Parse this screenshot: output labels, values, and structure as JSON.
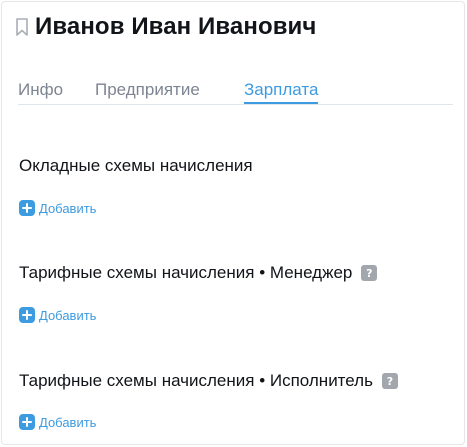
{
  "header": {
    "title": "Иванов Иван Иванович",
    "bookmark_icon": "bookmark-icon"
  },
  "tabs": [
    {
      "label": "Инфо",
      "active": false
    },
    {
      "label": "Предприятие",
      "active": false
    },
    {
      "label": "Зарплата",
      "active": true
    }
  ],
  "sections": [
    {
      "title": "Окладные схемы начисления",
      "help": false,
      "add_label": "Добавить"
    },
    {
      "title": "Тарифные схемы начисления • Менеджер",
      "help": true,
      "help_text": "?",
      "add_label": "Добавить"
    },
    {
      "title": "Тарифные схемы начисления • Исполнитель",
      "help": true,
      "help_text": "?",
      "add_label": "Добавить"
    }
  ],
  "colors": {
    "accent": "#3d9be0",
    "text": "#111418",
    "muted": "#7d8592",
    "help_badge": "#a2a7ae"
  }
}
